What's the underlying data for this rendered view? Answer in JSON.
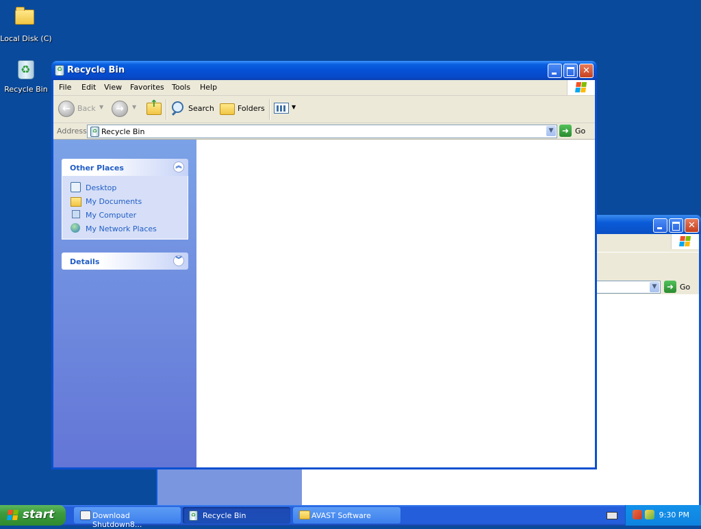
{
  "desktop": {
    "icons": [
      {
        "label": "Local Disk (C)"
      },
      {
        "label": "Recycle Bin"
      }
    ]
  },
  "window": {
    "title": "Recycle Bin",
    "menu": [
      "File",
      "Edit",
      "View",
      "Favorites",
      "Tools",
      "Help"
    ],
    "toolbar": {
      "back": "Back",
      "search": "Search",
      "folders": "Folders"
    },
    "address": {
      "label": "Address",
      "value": "Recycle Bin",
      "go": "Go"
    },
    "sidebar": {
      "other_places": {
        "title": "Other Places",
        "items": [
          {
            "label": "Desktop"
          },
          {
            "label": "My Documents"
          },
          {
            "label": "My Computer"
          },
          {
            "label": "My Network Places"
          }
        ]
      },
      "details": {
        "title": "Details"
      }
    }
  },
  "background_window": {
    "go": "Go"
  },
  "taskbar": {
    "start": "start",
    "tasks": [
      {
        "label": "Download Shutdown8..."
      },
      {
        "label": "Recycle Bin"
      },
      {
        "label": "AVAST Software"
      }
    ],
    "clock": "9:30 PM"
  },
  "colors": {
    "desktop": "#0a4a9c",
    "title_bar": "#0551d6",
    "link": "#215dc6"
  }
}
